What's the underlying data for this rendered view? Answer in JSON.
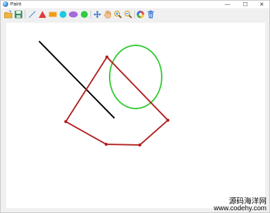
{
  "window": {
    "title": "Paint",
    "minimize_glyph": "—",
    "maximize_glyph": "☐",
    "close_glyph": "✕"
  },
  "toolbar": {
    "tools": [
      {
        "name": "open-icon",
        "color": "#e9a722"
      },
      {
        "name": "save-icon",
        "color": "#2e8b57"
      },
      {
        "name": "line-tool-icon",
        "color": "#4a90d9"
      },
      {
        "name": "triangle-tool-icon",
        "color": "#e03a3a"
      },
      {
        "name": "rectangle-tool-icon",
        "color": "#f39c12"
      },
      {
        "name": "circle-tool-icon",
        "color": "#1ec8e0"
      },
      {
        "name": "ellipse-tool-icon",
        "color": "#a46ad8"
      },
      {
        "name": "filled-circle-tool-icon",
        "color": "#2ecc40"
      },
      {
        "name": "move-tool-icon",
        "color": "#3a7bd5"
      },
      {
        "name": "hand-tool-icon",
        "color": "#e0a050"
      },
      {
        "name": "zoom-in-icon",
        "color": "#d4a017"
      },
      {
        "name": "zoom-out-icon",
        "color": "#d4a017"
      },
      {
        "name": "color-picker-icon",
        "color": "#e05050"
      },
      {
        "name": "trash-icon",
        "color": "#3a7bd5"
      }
    ]
  },
  "drawing": {
    "line_color": "#000000",
    "polygon_color": "#b22222",
    "circle_color": "#33cc33"
  },
  "watermark": {
    "line1": "源码海洋网",
    "line2": "www.codehy.com"
  }
}
